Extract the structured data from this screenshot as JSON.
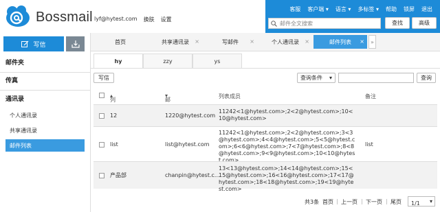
{
  "brand": {
    "name": "Bossmail",
    "accent": "#1d8bd8"
  },
  "user": {
    "email": "lyf@hytest.com",
    "skin": "换肤",
    "settings": "设置"
  },
  "topnav": [
    "客服",
    "客户端",
    "语言",
    "多标签",
    "帮助",
    "锁屏",
    "退出"
  ],
  "search": {
    "placeholder": "邮件全文搜索",
    "search_label": "查找",
    "advanced_label": "高级"
  },
  "sidebar": {
    "compose": "写信",
    "mail_folder": "邮件夹",
    "fax": "传真",
    "contacts": "通讯录",
    "items": [
      "个人通讯录",
      "共享通讯录",
      "邮件列表"
    ]
  },
  "tabs": [
    "首页",
    "共享通讯录",
    "写邮件",
    "个人通讯录",
    "邮件列表"
  ],
  "subtabs": [
    "hy",
    "zzy",
    "ys"
  ],
  "toolbar": {
    "write": "写信",
    "filter": "查询条件",
    "query": "查询"
  },
  "table": {
    "headers": [
      "列表名",
      "邮件列表",
      "列表成员",
      "备注"
    ],
    "rows": [
      {
        "name": "12",
        "list": "1220@hytest.com",
        "members": "11242<1@hytest.com>;2<2@hytest.com>;10<10@hytest.com>",
        "note": ""
      },
      {
        "name": "list",
        "list": "list@hytest.com",
        "members": "11242<1@hytest.com>;2<2@hytest.com>;3<3@hytest.com>;4<4@hytest.com>;5<5@hytest.com>;6<6@hytest.com>;7<7@hytest.com>;8<8@hytest.com>;9<9@hytest.com>;10<10@hytest.com>",
        "note": "list"
      },
      {
        "name": "产品部",
        "list": "chanpin@hytest.c...",
        "members": "13<13@hytest.com>;14<14@hytest.com>;15<15@hytest.com>;16<16@hytest.com>;17<17@hytest.com>;18<18@hytest.com>;19<19@hytest.com>",
        "note": ""
      }
    ]
  },
  "pager": {
    "total": "共3条",
    "first": "首页",
    "prev": "上一页",
    "next": "下一页",
    "last": "尾页",
    "page": "1/1"
  }
}
